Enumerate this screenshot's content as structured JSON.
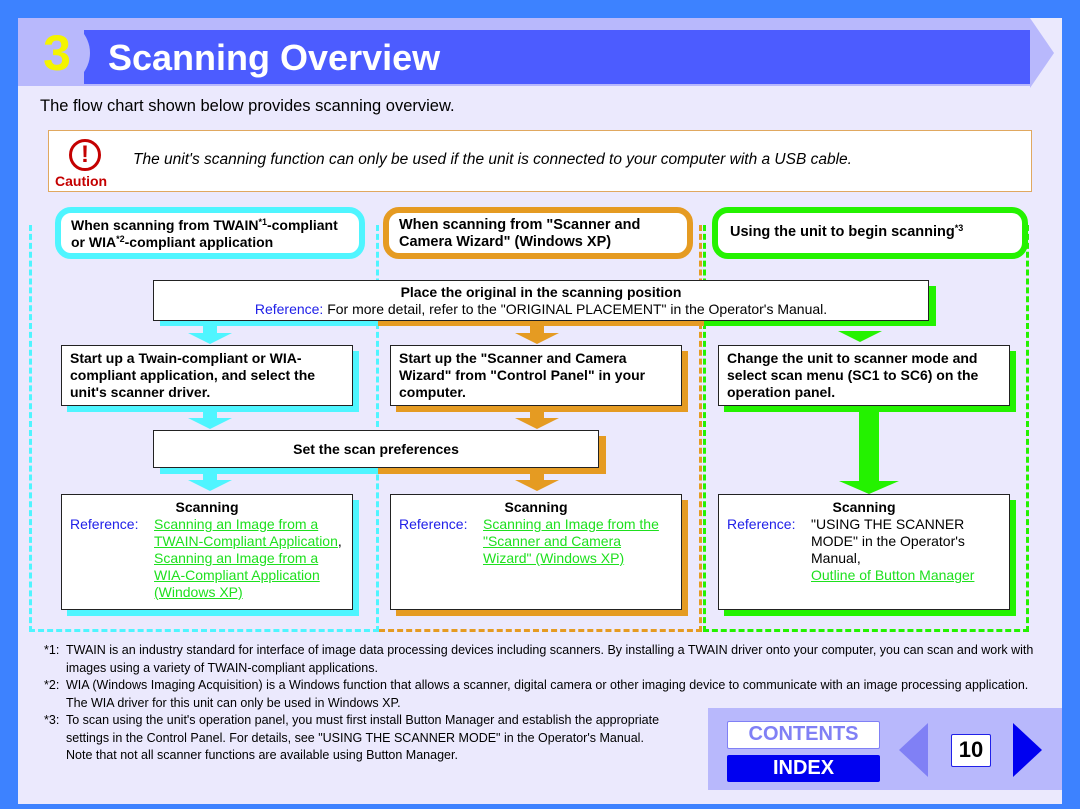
{
  "header": {
    "chapter_number": "3",
    "title": "Scanning Overview"
  },
  "intro": "The flow chart shown below provides scanning overview.",
  "caution": {
    "icon": "exclamation-circle-icon",
    "label": "Caution",
    "text": "The unit's scanning function can only be used if the unit is connected to your computer with a USB cable."
  },
  "colors": {
    "cyan": "#4ff5ff",
    "orange": "#e59b22",
    "green": "#24f200",
    "title_bar": "#4c5cff",
    "page_bg": "#ebe9fd",
    "outer_bg": "#3d82ff",
    "reference_label": "#2020e8",
    "link": "#1ee01e"
  },
  "columns": {
    "twain": {
      "header_pre": "When scanning from TWAIN",
      "header_sup1": "*1",
      "header_mid": "-compliant or WIA",
      "header_sup2": "*2",
      "header_post": "-compliant application",
      "step1": "Start up a Twain-compliant or WIA-compliant application, and select the unit's scanner driver.",
      "scan_title": "Scanning",
      "reference_label": "Reference:",
      "links": [
        "Scanning an Image from a TWAIN-Compliant Application",
        "Scanning an Image from a WIA-Compliant Application (Windows XP)"
      ],
      "link_separator": ","
    },
    "wizard": {
      "header": "When scanning from \"Scanner and Camera Wizard\" (Windows XP)",
      "step1": "Start up the \"Scanner and Camera Wizard\" from \"Control Panel\" in your computer.",
      "scan_title": "Scanning",
      "reference_label": "Reference:",
      "links": [
        "Scanning an Image from the \"Scanner and Camera Wizard\" (Windows XP)"
      ]
    },
    "unit": {
      "header": "Using the unit to begin scanning",
      "header_sup": "*3",
      "step1": "Change the unit to scanner mode and select scan menu (SC1 to SC6) on the operation panel.",
      "scan_title": "Scanning",
      "reference_label": "Reference:",
      "reference_text": "\"USING THE SCANNER MODE\" in the Operator's Manual,",
      "links": [
        "Outline of Button Manager"
      ]
    }
  },
  "shared_steps": {
    "place_original": {
      "title": "Place the original in the scanning position",
      "reference_label": "Reference:",
      "reference_text": "For more detail, refer to the \"ORIGINAL PLACEMENT\" in the Operator's Manual."
    },
    "preferences": {
      "title": "Set the scan preferences"
    }
  },
  "footnotes": [
    {
      "mark": "*1:",
      "text": "TWAIN is an industry standard for interface of image data processing devices including scanners. By installing a TWAIN driver onto your computer, you can scan and work with images using a variety of TWAIN-compliant applications."
    },
    {
      "mark": "*2:",
      "text": "WIA (Windows Imaging Acquisition) is a Windows function that allows a scanner, digital camera or other imaging device to communicate with an image processing application. The WIA driver for this unit can only be used in Windows XP."
    },
    {
      "mark": "*3:",
      "text": "To scan using the unit's operation panel, you must first install Button Manager and establish the appropriate settings in the Control Panel. For details, see \"USING THE SCANNER MODE\" in the Operator's Manual."
    }
  ],
  "footnote_extra": "Note that not all scanner functions are available using Button Manager.",
  "navigation": {
    "contents_label": "CONTENTS",
    "index_label": "INDEX",
    "page_number": "10",
    "prev_icon": "triangle-left-icon",
    "next_icon": "triangle-right-icon"
  }
}
